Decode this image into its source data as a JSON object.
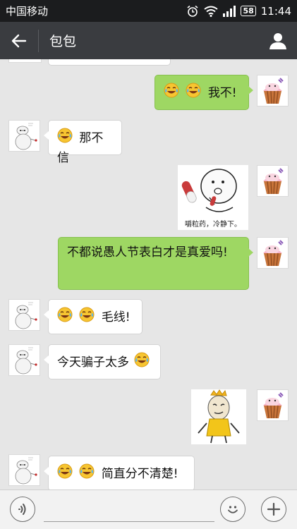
{
  "status_bar": {
    "carrier": "中国移动",
    "battery": "58",
    "time": "11:44"
  },
  "header": {
    "title": "包包"
  },
  "messages": [
    {
      "side": "right",
      "type": "text",
      "emojis": 2,
      "text": "我不!"
    },
    {
      "side": "left",
      "type": "text",
      "emojis": 1,
      "text": "那不信"
    },
    {
      "side": "right",
      "type": "sticker",
      "sticker": "pill-sticker",
      "caption": "嚼粒药，冷静下。"
    },
    {
      "side": "right",
      "type": "text",
      "emojis": 0,
      "text": "不都说愚人节表白才是真爱吗!"
    },
    {
      "side": "left",
      "type": "text",
      "emojis": 2,
      "text": "毛线!"
    },
    {
      "side": "left",
      "type": "text",
      "emojis": 0,
      "text": "今天骗子太多",
      "trailing_emoji": 1
    },
    {
      "side": "right",
      "type": "sticker",
      "sticker": "face-sticker"
    },
    {
      "side": "left",
      "type": "text",
      "emojis": 2,
      "text": "简直分不清楚!"
    }
  ],
  "input_bar": {
    "placeholder": ""
  },
  "colors": {
    "status_bg": "#1b1c1e",
    "header_bg": "#3a3c40",
    "chat_bg": "#e6e6e6",
    "sent_bubble": "#9ed763",
    "received_bubble": "#ffffff"
  },
  "icons": {
    "back": "back-arrow-icon",
    "profile": "person-icon",
    "voice": "voice-icon",
    "emoji": "smiley-icon",
    "more": "plus-icon",
    "laugh_emoji": "tears-of-joy-emoji"
  }
}
